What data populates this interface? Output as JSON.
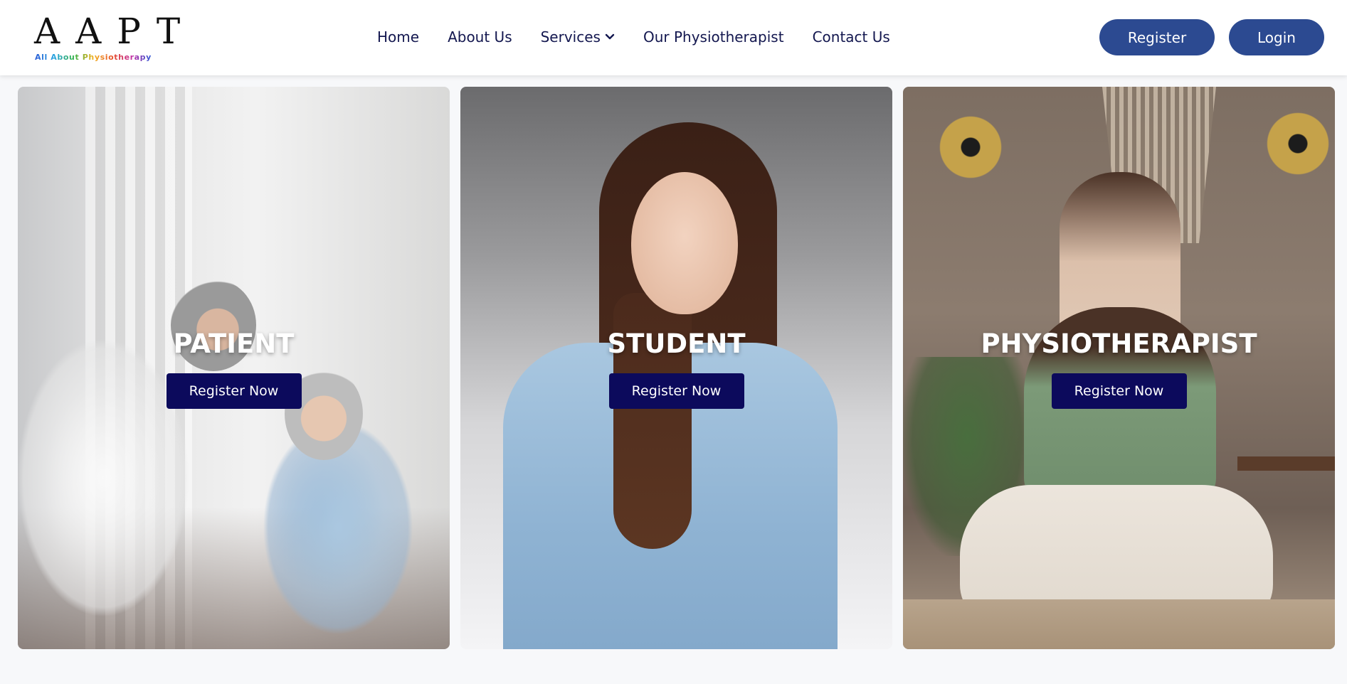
{
  "brand": {
    "logo_letters": "AAPT",
    "logo_tagline": "All About Physiotherapy"
  },
  "nav": {
    "items": [
      {
        "label": "Home"
      },
      {
        "label": "About Us"
      },
      {
        "label": "Services",
        "has_dropdown": true
      },
      {
        "label": "Our Physiotherapist"
      },
      {
        "label": "Contact Us"
      }
    ],
    "register_label": "Register",
    "login_label": "Login"
  },
  "cards": [
    {
      "title": "PATIENT",
      "button_label": "Register Now"
    },
    {
      "title": "STUDENT",
      "button_label": "Register Now"
    },
    {
      "title": "PHYSIOTHERAPIST",
      "button_label": "Register Now"
    }
  ],
  "colors": {
    "primary_button": "#2c4a91",
    "card_button": "#0c0a5c",
    "nav_text": "#13174f",
    "page_background": "#f7f8fa"
  },
  "icons": {
    "services_dropdown": "chevron-down-icon"
  }
}
